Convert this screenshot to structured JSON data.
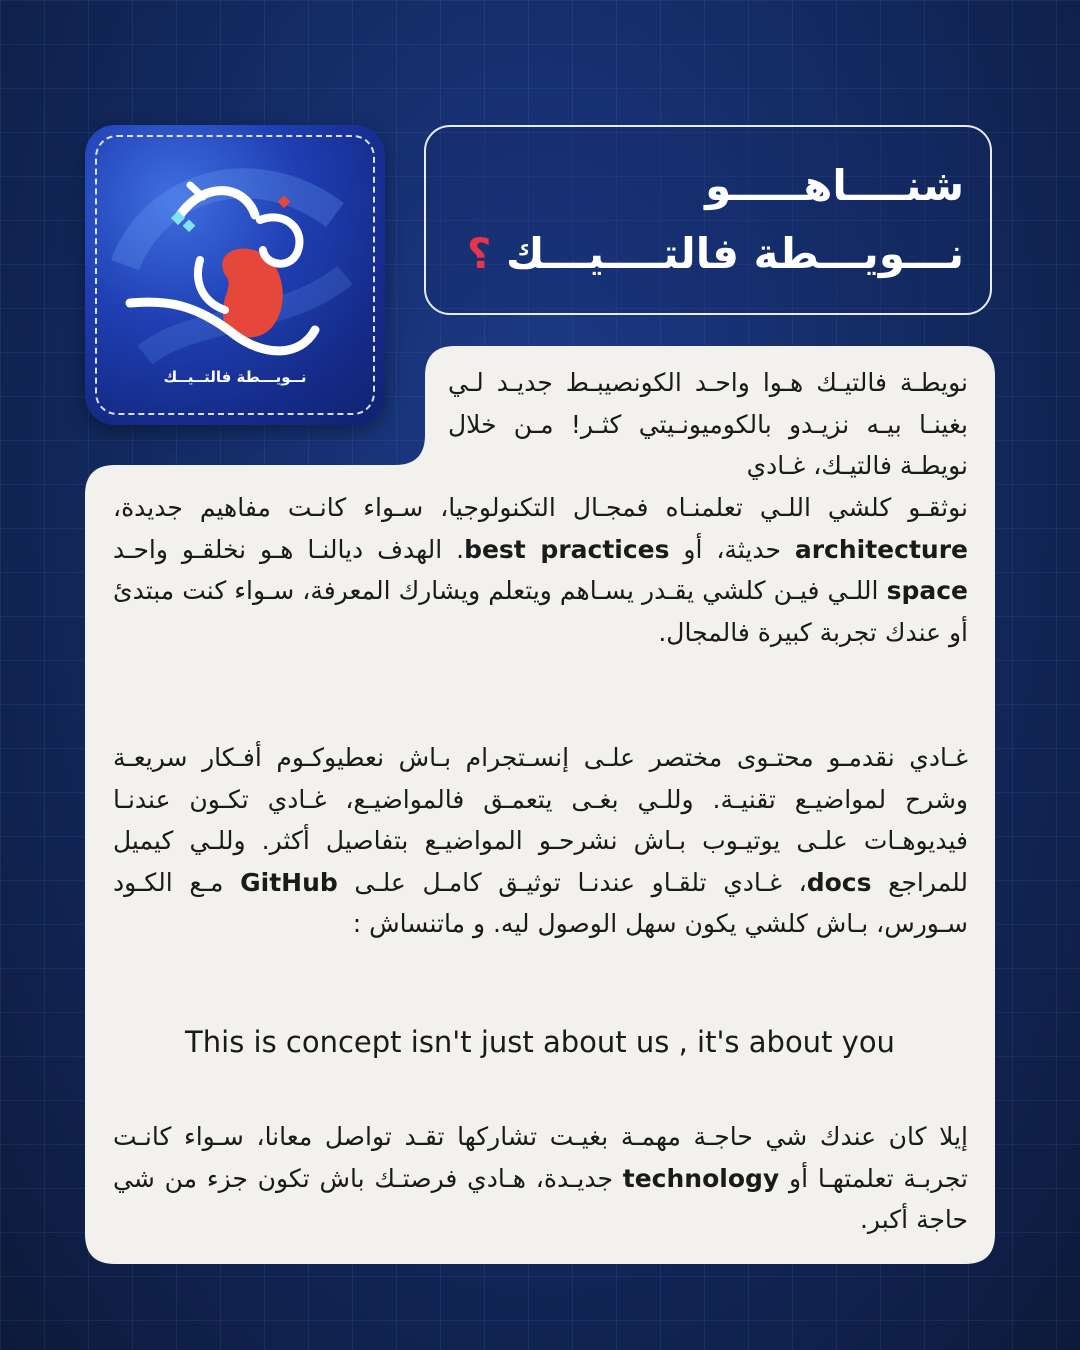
{
  "logo": {
    "caption": "نــويـــطة فالتــيــك"
  },
  "title": {
    "line1": "شنــــاهـــــو",
    "line2": "نـــويـــطة فالتــــيـــك",
    "question_mark": "؟"
  },
  "content": {
    "p1_top": "نويطـة فالتيـك هـوا واحـد الكونصيبـط جديـد لـي بغينـا بيـه نزيـدو بالكوميونـيتي كثـر! مـن خلال نويطـة فالتيـك، غـادي",
    "p1_line4": "نوثقـو كلشي اللـي تعلمنـاه فمجـال التكنولوجيا، سـواء كانـت مفاهيم جديدة، ",
    "p1_term1": "architecture",
    "p1_mid1": " حديثة، أو ",
    "p1_term2": "best practices",
    "p1_mid2": ". الهدف ديالنـا هـو نخلقـو واحـد ",
    "p1_term3": "space",
    "p1_end": " اللـي فيـن كلشي يقـدر يسـاهم ويتعلم ويشارك المعرفة، سـواء كنت مبتدئ أو عندك تجربة كبيرة فالمجال.",
    "p2_start": "غـادي نقدمـو محتـوى مختصر علـى إنسـتجرام بـاش نعطيوكـوم أفـكار سريعـة وشرح لمواضيـع تقنيـة. وللـي بغـى يتعمـق فالمواضيـع، غـادي تكـون عندنـا فيديوهـات علـى يوتيـوب بـاش نشرحـو المواضيـع بتفاصيل أكثر. وللـي كيميل للمراجع ",
    "p2_term1": "docs",
    "p2_mid": "، غـادي تلقـاو عندنـا توثيـق كامـل علـى ",
    "p2_term2": "GitHub",
    "p2_end": " مـع الكـود سـورس، بـاش كلشي يكون سهل الوصول ليه. و ماتنساش :",
    "english_line": "This is concept isn't just about us , it's about you",
    "p3_start": "إيلا كان عندك شي حاجـة مهمـة بغيـت تشاركها تقـد تواصل معانا، سـواء كانـت تجربـة تعلمتهـا أو ",
    "p3_term": "technology",
    "p3_end": " جديـدة، هـادي فرصتـك باش تكون جزء من شي حاجة أكبر."
  },
  "colors": {
    "background": "#13275a",
    "card": "#f2f1ee",
    "accent_question": "#e8344e",
    "logo_blob": "#e5483a"
  }
}
